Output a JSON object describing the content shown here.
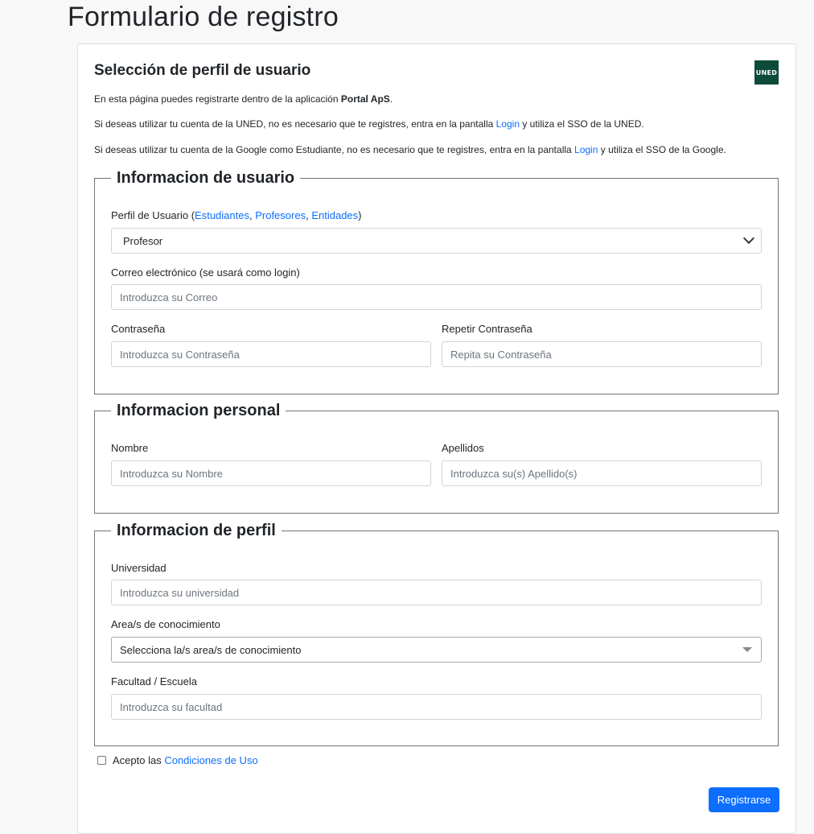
{
  "page": {
    "title": "Formulario de registro"
  },
  "card": {
    "title": "Selección de perfil de usuario",
    "logo_text": "UNED",
    "intro1": {
      "prefix": "En esta página puedes registrarte dentro de la aplicación ",
      "app": "Portal ApS",
      "suffix": "."
    },
    "intro2": {
      "prefix": "Si deseas utilizar tu cuenta de la UNED, no es necesario que te registres, entra en la pantalla ",
      "link": "Login",
      "suffix": " y utiliza el SSO de la UNED."
    },
    "intro3": {
      "prefix": "Si deseas utilizar tu cuenta de la Google como Estudiante, no es necesario que te registres, entra en la pantalla ",
      "link": "Login",
      "suffix": " y utiliza el SSO de la Google."
    }
  },
  "user_info": {
    "legend": "Informacion de usuario",
    "profile_label_prefix": "Perfil de Usuario (",
    "profile_links": [
      "Estudiantes",
      "Profesores",
      "Entidades"
    ],
    "profile_sep": ", ",
    "profile_label_suffix": ")",
    "profile_value": "Profesor",
    "email_label": "Correo electrónico (se usará como login)",
    "email_placeholder": "Introduzca su Correo",
    "password_label": "Contraseña",
    "password_placeholder": "Introduzca su Contraseña",
    "repeat_label": "Repetir Contraseña",
    "repeat_placeholder": "Repita su Contraseña"
  },
  "personal_info": {
    "legend": "Informacion personal",
    "name_label": "Nombre",
    "name_placeholder": "Introduzca su Nombre",
    "surname_label": "Apellidos",
    "surname_placeholder": "Introduzca su(s) Apellido(s)"
  },
  "profile_info": {
    "legend": "Informacion de perfil",
    "university_label": "Universidad",
    "university_placeholder": "Introduzca su universidad",
    "area_label": "Area/s de conocimiento",
    "area_value": "Selecciona la/s area/s de conocimiento",
    "faculty_label": "Facultad / Escuela",
    "faculty_placeholder": "Introduzca su facultad"
  },
  "terms": {
    "prefix": "Acepto las ",
    "link": "Condiciones de Uso"
  },
  "submit_label": "Registrarse",
  "colors": {
    "primary": "#0d6efd",
    "logo_bg": "#0c4a3a"
  }
}
